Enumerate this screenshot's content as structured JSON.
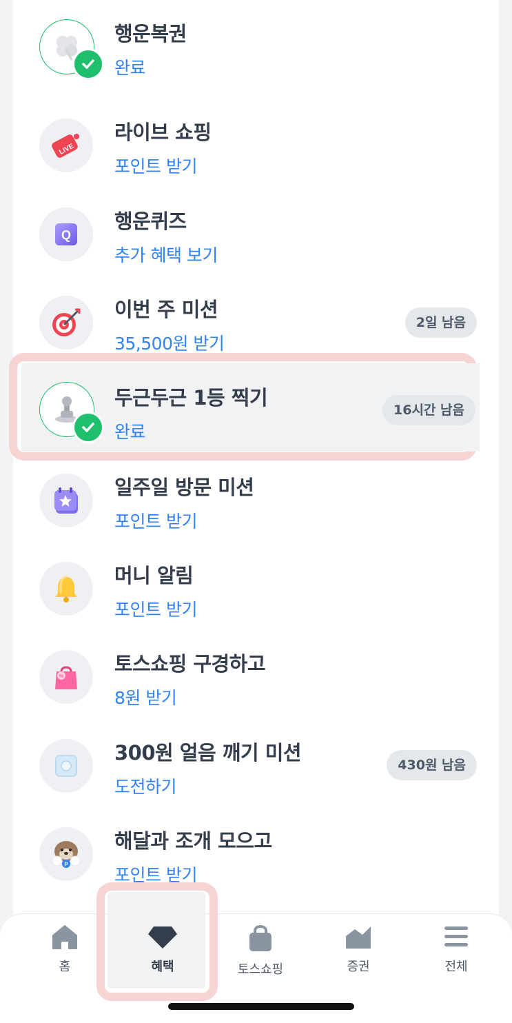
{
  "list": [
    {
      "title": "행운복권",
      "sub": "완료",
      "badge": null,
      "icon": "clover-icon",
      "done": true
    },
    {
      "title": "라이브 쇼핑",
      "sub": "포인트 받기",
      "badge": null,
      "icon": "live-tv-icon",
      "done": false
    },
    {
      "title": "행운퀴즈",
      "sub": "추가 혜택 보기",
      "badge": null,
      "icon": "quiz-cube-icon",
      "done": false
    },
    {
      "title": "이번 주 미션",
      "sub": "35,500원 받기",
      "badge": "2일 남음",
      "icon": "target-dart-icon",
      "done": false
    },
    {
      "title": "두근두근 1등 찍기",
      "sub": "완료",
      "badge": "16시간 남음",
      "icon": "stamp-icon",
      "done": true
    },
    {
      "title": "일주일 방문 미션",
      "sub": "포인트 받기",
      "badge": null,
      "icon": "calendar-star-icon",
      "done": false
    },
    {
      "title": "머니 알림",
      "sub": "포인트 받기",
      "badge": null,
      "icon": "bell-icon",
      "done": false
    },
    {
      "title": "토스쇼핑 구경하고",
      "sub": "8원 받기",
      "badge": null,
      "icon": "shopping-bag-icon",
      "done": false
    },
    {
      "title": "300원 얼음 깨기 미션",
      "sub": "도전하기",
      "badge": "430원 남음",
      "icon": "ice-cube-icon",
      "done": false
    },
    {
      "title": "해달과 조개 모으고",
      "sub": "포인트 받기",
      "badge": null,
      "icon": "otter-icon",
      "done": false
    }
  ],
  "tabs": [
    {
      "label": "홈",
      "icon": "home-icon"
    },
    {
      "label": "혜택",
      "icon": "gem-icon",
      "active": true
    },
    {
      "label": "토스쇼핑",
      "icon": "bag-icon"
    },
    {
      "label": "증권",
      "icon": "chart-icon"
    },
    {
      "label": "전체",
      "icon": "menu-icon"
    }
  ],
  "colors": {
    "accent": "#3182f6",
    "title": "#333d4b",
    "done_green": "#1fbf6e",
    "highlight": "#f7d4d4"
  }
}
